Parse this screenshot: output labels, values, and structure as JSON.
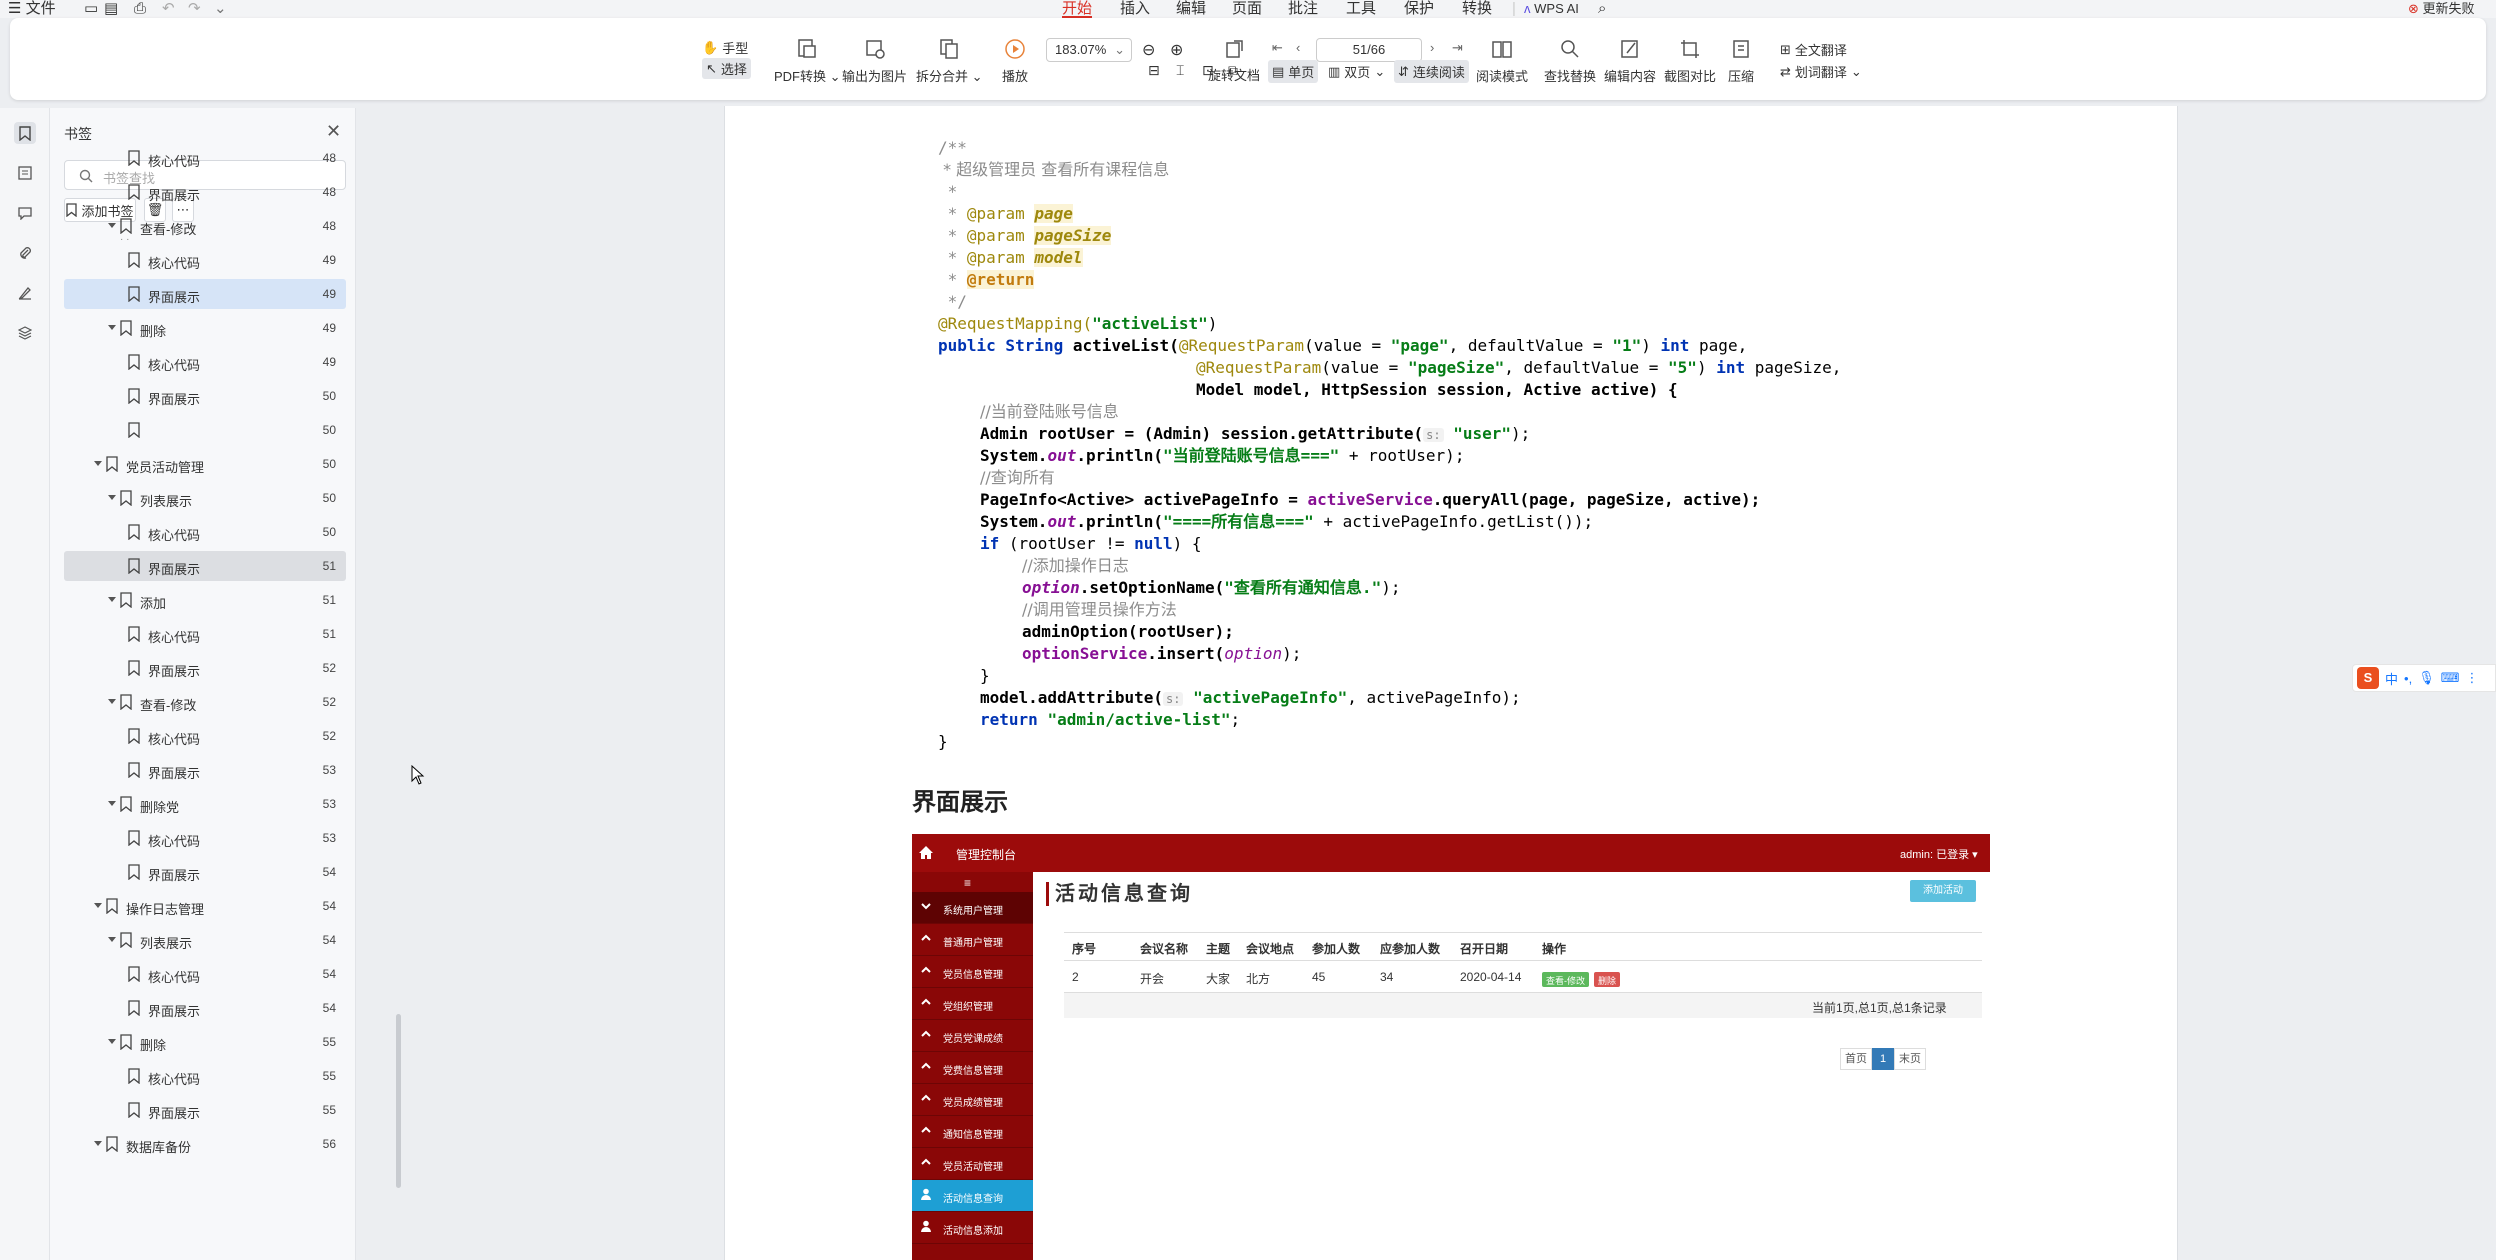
{
  "menubar": {
    "file": "文件",
    "tabs": [
      "开始",
      "插入",
      "编辑",
      "页面",
      "批注",
      "工具",
      "保护",
      "转换"
    ],
    "active_tab": "开始",
    "wps_ai": "WPS AI",
    "update_failed": "更新失败"
  },
  "toolbar": {
    "hand": "手型",
    "select": "选择",
    "pdf_convert": "PDF转换",
    "export_image": "输出为图片",
    "split_merge": "拆分合并",
    "play": "播放",
    "zoom": "183.07%",
    "page_indicator": "51/66",
    "rotate": "旋转文档",
    "single": "单页",
    "double": "双页",
    "continuous": "连续阅读",
    "read_mode": "阅读模式",
    "find_replace": "查找替换",
    "edit_content": "编辑内容",
    "screenshot_compare": "截图对比",
    "compress": "压缩",
    "full_translate": "全文翻译",
    "word_translate": "划词翻译"
  },
  "bookmarks": {
    "title": "书签",
    "search_placeholder": "书签查找",
    "add_label": "添加书签",
    "items": [
      {
        "label": "核心代码",
        "page": "48",
        "level": 2
      },
      {
        "label": "界面展示",
        "page": "48",
        "level": 2
      },
      {
        "label": "查看-修改",
        "page": "48",
        "level": 1
      },
      {
        "label": "核心代码",
        "page": "49",
        "level": 2
      },
      {
        "label": "界面展示",
        "page": "49",
        "level": 2,
        "selected": true
      },
      {
        "label": "删除",
        "page": "49",
        "level": 1
      },
      {
        "label": "核心代码",
        "page": "49",
        "level": 2
      },
      {
        "label": "界面展示",
        "page": "50",
        "level": 2
      },
      {
        "label": "",
        "page": "50",
        "level": 2
      },
      {
        "label": "党员活动管理",
        "page": "50",
        "level": 0
      },
      {
        "label": "列表展示",
        "page": "50",
        "level": 1
      },
      {
        "label": "核心代码",
        "page": "50",
        "level": 2
      },
      {
        "label": "界面展示",
        "page": "51",
        "level": 2,
        "hover": true
      },
      {
        "label": "添加",
        "page": "51",
        "level": 1
      },
      {
        "label": "核心代码",
        "page": "51",
        "level": 2
      },
      {
        "label": "界面展示",
        "page": "52",
        "level": 2
      },
      {
        "label": "查看-修改",
        "page": "52",
        "level": 1
      },
      {
        "label": "核心代码",
        "page": "52",
        "level": 2
      },
      {
        "label": "界面展示",
        "page": "53",
        "level": 2
      },
      {
        "label": "删除党",
        "page": "53",
        "level": 1
      },
      {
        "label": "核心代码",
        "page": "53",
        "level": 2
      },
      {
        "label": "界面展示",
        "page": "54",
        "level": 2
      },
      {
        "label": "操作日志管理",
        "page": "54",
        "level": 0
      },
      {
        "label": "列表展示",
        "page": "54",
        "level": 1
      },
      {
        "label": "核心代码",
        "page": "54",
        "level": 2
      },
      {
        "label": "界面展示",
        "page": "54",
        "level": 2
      },
      {
        "label": "删除",
        "page": "55",
        "level": 1
      },
      {
        "label": "核心代码",
        "page": "55",
        "level": 2
      },
      {
        "label": "界面展示",
        "page": "55",
        "level": 2
      },
      {
        "label": "数据库备份",
        "page": "56",
        "level": 0
      }
    ]
  },
  "code": {
    "l1": "/**",
    "l2": " * 超级管理员 查看所有课程信息",
    "l3": " *",
    "l4a": " * ",
    "l4b": "@param",
    "l4c": "page",
    "l5c": "pageSize",
    "l6c": "model",
    "l7b": "@return",
    "l8": " */",
    "l9a": "@RequestMapping(",
    "l9b": "\"activeList\"",
    "l9c": ")",
    "l10a": "public String ",
    "l10b": "activeList(",
    "l10c": "@RequestParam",
    "l10d": "(value = ",
    "l10e": "\"page\"",
    "l10f": ", defaultValue = ",
    "l10g": "\"1\"",
    "l10h": ") ",
    "l10i": "int",
    "l10j": " page,",
    "l11e": "\"pageSize\"",
    "l11g": "\"5\"",
    "l11j": " pageSize,",
    "l12": "Model model, HttpSession session, Active active) {",
    "l13": "//当前登陆账号信息",
    "l14a": "Admin rootUser = (Admin) session.",
    "l14b": "getAttribute(",
    "l14h": "s:",
    "l14c": "\"user\"",
    "l14d": ");",
    "l15a": "System.",
    "l15b": "out",
    "l15c": ".println(",
    "l15d": "\"当前登陆账号信息===\"",
    "l15e": " + rootUser);",
    "l16": "//查询所有",
    "l17a": "PageInfo<Active> activePageInfo = ",
    "l17b": "activeService",
    "l17c": ".queryAll(page, pageSize, active);",
    "l18d": "\"====所有信息===\"",
    "l18e": " + activePageInfo.getList());",
    "l19a": "if",
    "l19b": " (rootUser != ",
    "l19c": "null",
    "l19d": ") {",
    "l20": "//添加操作日志",
    "l21a": "option",
    "l21b": ".setOptionName(",
    "l21c": "\"查看所有通知信息.\"",
    "l21d": ");",
    "l22": "//调用管理员操作方法",
    "l23": "adminOption(rootUser);",
    "l24a": "optionService",
    "l24b": ".insert(",
    "l24c": "option",
    "l24d": ");",
    "l25": "}",
    "l26a": "model.addAttribute(",
    "l26h": "s:",
    "l26c": "\"activePageInfo\"",
    "l26d": ", activePageInfo);",
    "l27a": "return",
    "l27b": "\"admin/active-list\"",
    "l27c": ";",
    "l28": "}"
  },
  "doc_heading": "界面展示",
  "embedded": {
    "app_title": "管理控制台",
    "user": "admin: 已登录",
    "page_title": "活动信息查询",
    "add_button": "添加活动",
    "menu": [
      "系统用户管理",
      "普通用户管理",
      "党员信息管理",
      "党组织管理",
      "党员党课成绩",
      "党费信息管理",
      "党员成绩管理",
      "通知信息管理",
      "党员活动管理",
      "活动信息查询",
      "活动信息添加"
    ],
    "columns": [
      "序号",
      "会议名称",
      "主题",
      "会议地点",
      "参加人数",
      "应参加人数",
      "召开日期",
      "操作"
    ],
    "row": [
      "2",
      "开会",
      "大家",
      "北方",
      "45",
      "34",
      "2020-04-14"
    ],
    "edit_btn": "查看-修改",
    "del_btn": "删除",
    "paging_info": "当前1页,总1页,总1条记录",
    "first": "首页",
    "current": "1",
    "last": "末页"
  },
  "ime": {
    "lang": "中"
  },
  "colors": {
    "accent": "#d93025",
    "brand_red": "#9c0b0b",
    "selected": "#d6e4f7",
    "embedded_active": "#1e9fd4"
  }
}
